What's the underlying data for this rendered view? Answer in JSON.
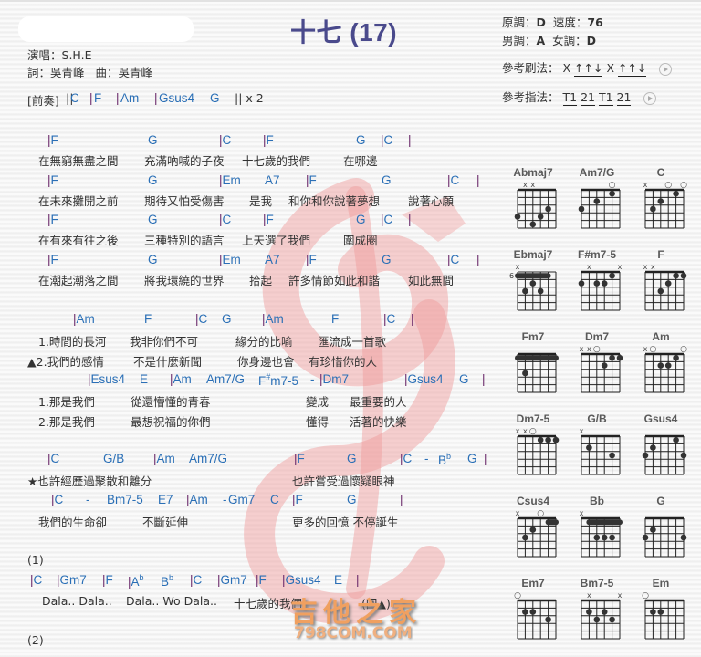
{
  "header": {
    "title": "十七 (17)",
    "singer_label": "演唱：",
    "singer": "S.H.E",
    "lyricist_label": "詞：",
    "lyricist": "吳青峰",
    "composer_label": "曲：",
    "composer": "吳青峰"
  },
  "key_info": {
    "original_key_label": "原調：",
    "original_key": "D",
    "tempo_label": "速度：",
    "tempo": "76",
    "male_key_label": "男調：",
    "male_key": "A",
    "female_key_label": "女調：",
    "female_key": "D",
    "strum_label": "參考刷法：",
    "strum_parts": [
      "X",
      "↑↑↓",
      "X",
      "↑↑↓"
    ],
    "finger_label": "參考指法：",
    "finger_parts": [
      "T1",
      "21",
      "T1",
      "21"
    ]
  },
  "intro": {
    "label": "[前奏]",
    "start": "||",
    "chords": [
      "C",
      "F",
      "Am",
      "Gsus4",
      "G"
    ],
    "end": "|| x 2"
  },
  "verse": [
    {
      "chords": [
        "|F",
        "G",
        "|C",
        "|F",
        "G",
        "|C",
        "|"
      ],
      "lyrics": [
        "在無窮無盡之間",
        "充滿吶喊的子夜",
        "十七歲的我們",
        "在哪邊"
      ]
    },
    {
      "chords": [
        "|F",
        "G",
        "|Em",
        "A7",
        "|F",
        "G",
        "|C",
        "|"
      ],
      "lyrics": [
        "在未來攤開之前",
        "期待又怕受傷害",
        "是我",
        "和你和你說著夢想",
        "說著心願"
      ]
    },
    {
      "chords": [
        "|F",
        "G",
        "|C",
        "|F",
        "G",
        "|C",
        "|"
      ],
      "lyrics": [
        "在有來有往之後",
        "三種特別的語言",
        "上天選了我們",
        "圍成圈"
      ]
    },
    {
      "chords": [
        "|F",
        "G",
        "|Em",
        "A7",
        "|F",
        "G",
        "|C",
        "|"
      ],
      "lyrics": [
        "在潮起潮落之間",
        "將我環繞的世界",
        "拾起",
        "許多情節如此和諧",
        "如此無間"
      ]
    }
  ],
  "prechorus": {
    "chords1": [
      "|Am",
      "F",
      "|C",
      "G",
      "|Am",
      "F",
      "|C",
      "|"
    ],
    "line1a": [
      "1.時間的長河",
      "我非你們不可",
      "緣分的比喻",
      "匯流成一首歌"
    ],
    "line1b": [
      "▲2.我們的感情",
      "不是什麼新聞",
      "你身邊也會",
      "有珍惜你的人"
    ],
    "chords2": [
      "|Esus4",
      "E",
      "|Am",
      "Am7/G",
      "F#m7-5",
      "-",
      "|Dm7",
      "|Gsus4",
      "G",
      "|"
    ],
    "line2a": [
      "1.那是我們",
      "從還懵懂的青春",
      "變成",
      "最重要的人"
    ],
    "line2b": [
      "2.那是我們",
      "最想祝福的你們",
      "懂得",
      "活著的快樂"
    ]
  },
  "chorus": {
    "chords1": [
      "|C",
      "G/B",
      "|Am",
      "Am7/G",
      "|F",
      "G",
      "|C",
      "-",
      "Bb",
      "G",
      "|"
    ],
    "line1": [
      "★也許經歷過聚散和離分",
      "也許嘗受過懷疑眼神"
    ],
    "chords2": [
      "|C",
      "-",
      "Bm7-5",
      "E7",
      "|Am",
      "-",
      "Gm7",
      "C",
      "|F",
      "G",
      "|"
    ],
    "line2": [
      "我們的生命卻",
      "不斷延伸",
      "更多的回憶 不停誕生"
    ]
  },
  "ending1": {
    "label": "(1)",
    "chords": [
      "|C",
      "|Gm7",
      "|F",
      "|Ab",
      "Bb",
      "|C",
      "|Gm7",
      "|F",
      "|Gsus4",
      "E",
      "|"
    ],
    "lyrics": [
      "Dala.. Dala..",
      "Dala.. Wo Dala..",
      "十七歲的我們",
      "(回▲)"
    ]
  },
  "ending2": {
    "label": "(2)"
  },
  "chord_diagrams": [
    {
      "name": "Abmaj7",
      "top": [
        "",
        "x",
        "x",
        "",
        "",
        ""
      ],
      "dots": [
        [
          1,
          4
        ],
        [
          4,
          4
        ],
        [
          5,
          3
        ],
        [
          3,
          5
        ]
      ],
      "barre": null,
      "fret": ""
    },
    {
      "name": "Am7/G",
      "top": [
        "",
        "",
        "",
        "",
        "o",
        ""
      ],
      "dots": [
        [
          1,
          3
        ],
        [
          3,
          2
        ],
        [
          5,
          1
        ]
      ],
      "barre": null,
      "fret": ""
    },
    {
      "name": "C",
      "top": [
        "x",
        "",
        "",
        "o",
        "",
        "o"
      ],
      "dots": [
        [
          2,
          3
        ],
        [
          3,
          2
        ],
        [
          5,
          1
        ]
      ],
      "barre": null,
      "fret": ""
    },
    {
      "name": "Ebmaj7",
      "top": [
        "x",
        "",
        "",
        "",
        "",
        ""
      ],
      "dots": [
        [
          3,
          2
        ],
        [
          2,
          3
        ],
        [
          4,
          3
        ]
      ],
      "barre": [
        1,
        1,
        5
      ],
      "fret": "6"
    },
    {
      "name": "F#m7-5",
      "top": [
        "",
        "x",
        "",
        "",
        "",
        "x"
      ],
      "dots": [
        [
          1,
          2
        ],
        [
          3,
          2
        ],
        [
          4,
          2
        ],
        [
          5,
          1
        ]
      ],
      "barre": null,
      "fret": ""
    },
    {
      "name": "F",
      "top": [
        "x",
        "x",
        "",
        "",
        "",
        ""
      ],
      "dots": [
        [
          5,
          1
        ],
        [
          6,
          1
        ],
        [
          4,
          2
        ],
        [
          3,
          3
        ]
      ],
      "barre": null,
      "fret": ""
    },
    {
      "name": "Fm7",
      "top": [
        "",
        "",
        "",
        "",
        "",
        ""
      ],
      "dots": [
        [
          2,
          3
        ]
      ],
      "barre": [
        1,
        1,
        6
      ],
      "fret": ""
    },
    {
      "name": "Dm7",
      "top": [
        "x",
        "x",
        "o",
        "",
        "",
        ""
      ],
      "dots": [
        [
          5,
          1
        ],
        [
          6,
          1
        ],
        [
          4,
          2
        ]
      ],
      "barre": null,
      "fret": ""
    },
    {
      "name": "Am",
      "top": [
        "x",
        "o",
        "",
        "",
        "",
        "o"
      ],
      "dots": [
        [
          5,
          1
        ],
        [
          3,
          2
        ],
        [
          4,
          2
        ]
      ],
      "barre": null,
      "fret": ""
    },
    {
      "name": "Dm7-5",
      "top": [
        "x",
        "x",
        "o",
        "",
        "",
        ""
      ],
      "dots": [
        [
          4,
          1
        ],
        [
          5,
          1
        ],
        [
          6,
          1
        ]
      ],
      "barre": null,
      "fret": ""
    },
    {
      "name": "G/B",
      "top": [
        "x",
        "",
        "",
        "",
        "",
        ""
      ],
      "dots": [
        [
          2,
          2
        ],
        [
          5,
          3
        ]
      ],
      "barre": null,
      "fret": ""
    },
    {
      "name": "Gsus4",
      "top": [
        "",
        "",
        "",
        "",
        "",
        ""
      ],
      "dots": [
        [
          5,
          1
        ],
        [
          2,
          2
        ],
        [
          1,
          3
        ],
        [
          6,
          3
        ]
      ],
      "barre": null,
      "fret": ""
    },
    {
      "name": "Csus4",
      "top": [
        "x",
        "",
        "",
        "o",
        "",
        ""
      ],
      "dots": [
        [
          3,
          2
        ],
        [
          2,
          3
        ]
      ],
      "barre": [
        1,
        5,
        6
      ],
      "fret": ""
    },
    {
      "name": "Bb",
      "top": [
        "x",
        "",
        "",
        "",
        "",
        ""
      ],
      "dots": [
        [
          3,
          3
        ],
        [
          4,
          3
        ],
        [
          5,
          3
        ]
      ],
      "barre": [
        1,
        2,
        6
      ],
      "fret": ""
    },
    {
      "name": "G",
      "top": [
        "",
        "",
        "",
        "",
        "",
        ""
      ],
      "dots": [
        [
          2,
          2
        ],
        [
          1,
          3
        ],
        [
          6,
          3
        ]
      ],
      "barre": null,
      "fret": ""
    },
    {
      "name": "Em7",
      "top": [
        "o",
        "",
        "",
        "",
        "",
        ""
      ],
      "dots": [
        [
          2,
          2
        ],
        [
          3,
          2
        ],
        [
          5,
          3
        ]
      ],
      "barre": null,
      "fret": ""
    },
    {
      "name": "Bm7-5",
      "top": [
        "",
        "x",
        "",
        "",
        "",
        "x"
      ],
      "dots": [
        [
          2,
          2
        ],
        [
          4,
          2
        ],
        [
          3,
          3
        ],
        [
          5,
          3
        ]
      ],
      "barre": null,
      "fret": ""
    },
    {
      "name": "Em",
      "top": [
        "o",
        "",
        "",
        "",
        "",
        ""
      ],
      "dots": [
        [
          2,
          2
        ],
        [
          3,
          2
        ]
      ],
      "barre": null,
      "fret": ""
    }
  ],
  "watermark": {
    "line1": "吉他之家",
    "line2": "798COM.COM"
  },
  "colors": {
    "title": "#4a4a8c",
    "chord": "#2a6fb6",
    "bar": "#6b2a6b",
    "watermark_red": "#e85a5a"
  }
}
